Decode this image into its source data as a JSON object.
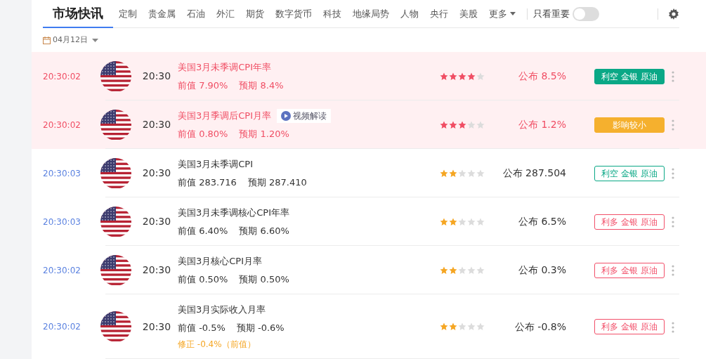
{
  "tabs": [
    {
      "label": "市场快讯",
      "selected": true
    },
    {
      "label": "定制",
      "selected": false
    },
    {
      "label": "贵金属",
      "selected": false
    },
    {
      "label": "石油",
      "selected": false
    },
    {
      "label": "外汇",
      "selected": false
    },
    {
      "label": "期货",
      "selected": false
    },
    {
      "label": "数字货币",
      "selected": false
    },
    {
      "label": "科技",
      "selected": false
    },
    {
      "label": "地缘局势",
      "selected": false
    },
    {
      "label": "人物",
      "selected": false
    },
    {
      "label": "央行",
      "selected": false
    },
    {
      "label": "美股",
      "selected": false
    }
  ],
  "more": "更多",
  "filter": {
    "label": "只看重要",
    "on": false
  },
  "date": "04月12日",
  "rows": [
    {
      "time": "20:30:02",
      "important": true,
      "event_time": "20:30",
      "title": "美国3月未季调CPI年率",
      "previous": "前值 7.90%",
      "forecast": "预期 8.4%",
      "stars": 4,
      "actual": "公布 8.5%",
      "tag": {
        "label": "利空 金银 原油",
        "kind": "solid",
        "color": "#0aa886"
      }
    },
    {
      "time": "20:30:02",
      "important": true,
      "event_time": "20:30",
      "title": "美国3月季调后CPI月率",
      "video": "视频解读",
      "previous": "前值 0.80%",
      "forecast": "预期 1.20%",
      "stars": 3,
      "actual": "公布 1.2%",
      "tag": {
        "label": "影响较小",
        "kind": "solid",
        "color": "#f5b02e"
      }
    },
    {
      "time": "20:30:03",
      "important": false,
      "event_time": "20:30",
      "title": "美国3月未季调CPI",
      "previous": "前值 283.716",
      "forecast": "预期 287.410",
      "stars": 2,
      "actual": "公布 287.504",
      "tag": {
        "label": "利空 金银 原油",
        "kind": "outline",
        "color": "#0aa886"
      }
    },
    {
      "time": "20:30:03",
      "important": false,
      "event_time": "20:30",
      "title": "美国3月未季调核心CPI年率",
      "previous": "前值 6.40%",
      "forecast": "预期 6.60%",
      "stars": 2,
      "actual": "公布 6.5%",
      "tag": {
        "label": "利多 金银 原油",
        "kind": "outline",
        "color": "#f2506a"
      }
    },
    {
      "time": "20:30:02",
      "important": false,
      "event_time": "20:30",
      "title": "美国3月核心CPI月率",
      "previous": "前值 0.50%",
      "forecast": "预期 0.50%",
      "stars": 2,
      "actual": "公布 0.3%",
      "tag": {
        "label": "利多 金银 原油",
        "kind": "outline",
        "color": "#f2506a"
      }
    },
    {
      "time": "20:30:02",
      "important": false,
      "event_time": "20:30",
      "title": "美国3月实际收入月率",
      "previous": "前值 -0.5%",
      "forecast": "预期 -0.6%",
      "revision": "修正 -0.4%（前值）",
      "stars": 2,
      "actual": "公布 -0.8%",
      "tag": {
        "label": "利多 金银 原油",
        "kind": "outline",
        "color": "#f2506a"
      }
    }
  ]
}
